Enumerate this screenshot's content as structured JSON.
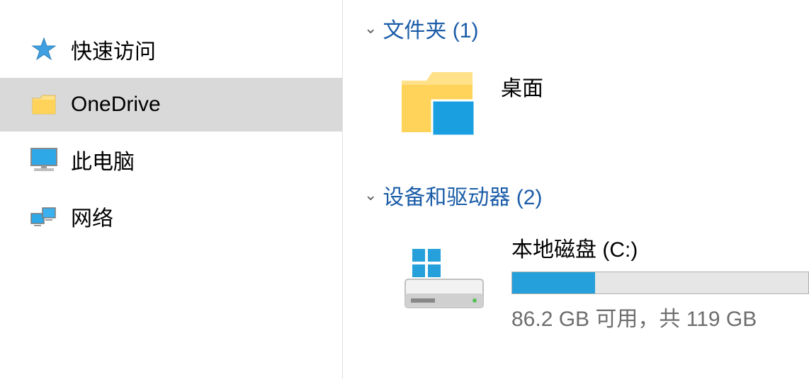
{
  "sidebar": {
    "items": [
      {
        "label": "快速访问",
        "icon": "star-icon"
      },
      {
        "label": "OneDrive",
        "icon": "folder-icon"
      },
      {
        "label": "此电脑",
        "icon": "monitor-icon"
      },
      {
        "label": "网络",
        "icon": "network-icon"
      }
    ]
  },
  "main": {
    "sections": [
      {
        "title": "文件夹 (1)",
        "items": [
          {
            "label": "桌面",
            "type": "folder"
          }
        ]
      },
      {
        "title": "设备和驱动器 (2)",
        "items": [
          {
            "label": "本地磁盘 (C:)",
            "type": "drive",
            "size_text": "86.2 GB 可用，共 119 GB",
            "used_percent": 28
          }
        ]
      }
    ]
  },
  "colors": {
    "accent": "#26a0da",
    "link": "#1a5ca8"
  }
}
